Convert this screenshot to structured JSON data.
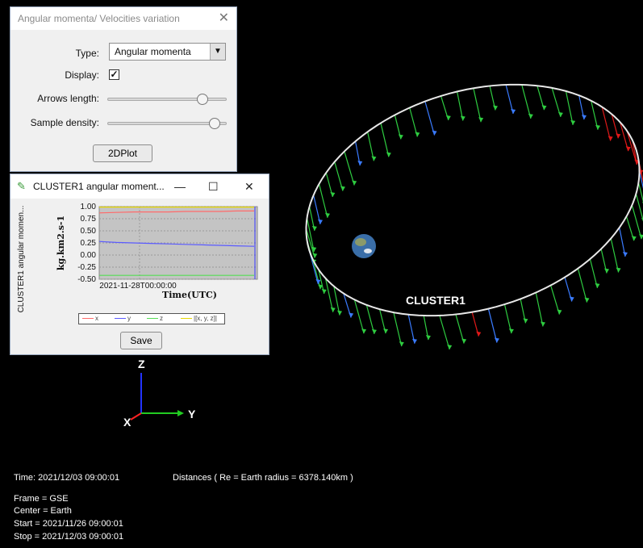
{
  "orbit_window": {
    "title": "Angular momenta/ Velocities variation",
    "close_icon": "close-icon",
    "type_label": "Type:",
    "type_value": "Angular momenta",
    "display_label": "Display:",
    "display_checked": true,
    "arrows_label": "Arrows length:",
    "arrows_value": 0.8,
    "density_label": "Sample density:",
    "density_value": 0.9,
    "plot_button": "2DPlot"
  },
  "plot_window": {
    "title": "CLUSTER1 angular moment...",
    "minimize": "—",
    "maximize": "☐",
    "close": "✕",
    "side_label": "CLUSTER1 angular momen...",
    "save_button": "Save"
  },
  "chart_data": {
    "type": "line",
    "ylabel": "kg.km2.s-1",
    "xlabel": "Time(UTC)",
    "x_tick": "2021-11-28T00:00:00",
    "ylim": [
      -0.5,
      1.0
    ],
    "y_ticks": [
      "1.00",
      "0.75",
      "0.50",
      "0.25",
      "0.00",
      "-0.25",
      "-0.50"
    ],
    "grid": true,
    "legend_placement": "bottom",
    "series": [
      {
        "name": "x",
        "color": "#ff6a6a",
        "values": [
          0.87,
          0.88,
          0.89,
          0.89,
          0.89,
          0.9,
          0.9,
          0.9,
          0.91,
          0.91
        ]
      },
      {
        "name": "y",
        "color": "#5a5aff",
        "values": [
          0.28,
          0.26,
          0.25,
          0.24,
          0.23,
          0.22,
          0.21,
          0.2,
          0.19,
          0.18
        ]
      },
      {
        "name": "z",
        "color": "#55dd55",
        "values": [
          -0.42,
          -0.42,
          -0.42,
          -0.42,
          -0.42,
          -0.42,
          -0.42,
          -0.42,
          -0.42,
          -0.42
        ]
      },
      {
        "name": "|[x, y, z]|",
        "color": "#e6d700",
        "values": [
          0.99,
          0.99,
          0.99,
          0.99,
          0.99,
          0.99,
          0.99,
          0.99,
          0.99,
          0.99
        ]
      }
    ]
  },
  "scene": {
    "spacecraft_label": "CLUSTER1",
    "axis_z": "Z",
    "axis_y": "Y",
    "axis_x": "X",
    "earth_icon": "earth-icon"
  },
  "info": {
    "time": "Time: 2021/12/03 09:00:01",
    "distances": "Distances ( Re = Earth radius = 6378.140km )",
    "frame": "Frame = GSE",
    "center": "Center = Earth",
    "start": "Start = 2021/11/26 09:00:01",
    "stop": "Stop = 2021/12/03 09:00:01"
  },
  "colors": {
    "background": "#000000",
    "orbit": "#e8e8e8",
    "arrow_green": "#2ecc40",
    "arrow_blue": "#3a7bff",
    "arrow_red": "#e01818"
  }
}
